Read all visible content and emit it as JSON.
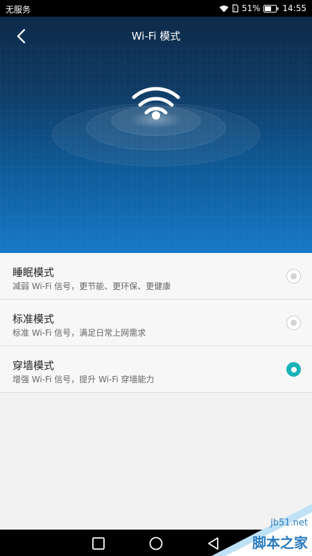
{
  "status_bar": {
    "carrier": "无服务",
    "battery": "51%",
    "time": "14:55"
  },
  "header": {
    "title": "Wi-Fi 模式"
  },
  "modes": [
    {
      "title": "睡眠模式",
      "desc": "减弱 Wi-Fi 信号，更节能、更环保、更健康",
      "selected": false
    },
    {
      "title": "标准模式",
      "desc": "标准 Wi-Fi 信号，满足日常上网需求",
      "selected": false
    },
    {
      "title": "穿墙模式",
      "desc": "增强 Wi-Fi 信号，提升 Wi-Fi 穿墙能力",
      "selected": true
    }
  ],
  "watermark": {
    "site": "jb51.net",
    "name": "脚本之家"
  },
  "colors": {
    "accent": "#19b3b6",
    "hero_top": "#0e2a49",
    "hero_bottom": "#1779c7"
  }
}
